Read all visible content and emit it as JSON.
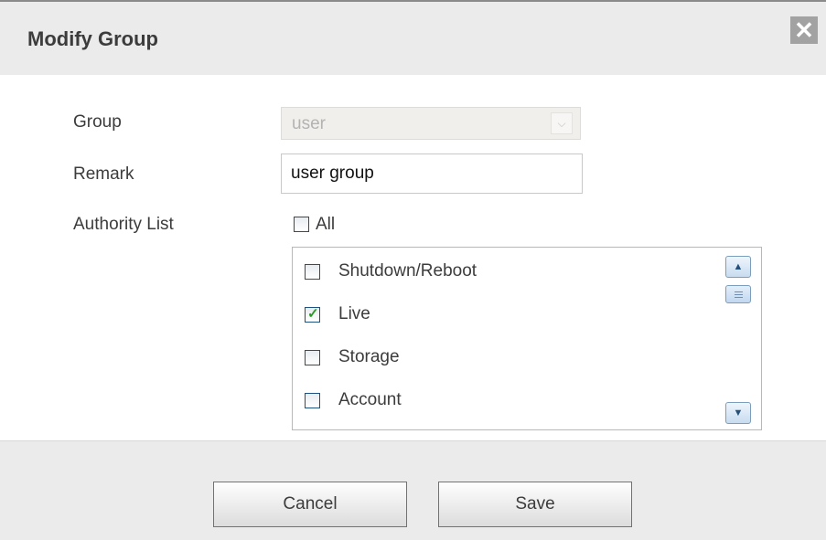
{
  "dialog": {
    "title": "Modify Group",
    "close_symbol": "✕"
  },
  "form": {
    "group_label": "Group",
    "group_value": "user",
    "remark_label": "Remark",
    "remark_value": "user group",
    "authority_label": "Authority List",
    "all_label": "All",
    "all_checked": false
  },
  "authority_items": [
    {
      "label": "Shutdown/Reboot",
      "checked": false
    },
    {
      "label": "Live",
      "checked": true
    },
    {
      "label": "Storage",
      "checked": false
    },
    {
      "label": "Account",
      "checked": false
    }
  ],
  "icons": {
    "close": "close-icon",
    "dropdown": "chevron-down-icon",
    "scroll_up": "chevron-up-icon",
    "scroll_down": "chevron-down-icon",
    "check": "checkmark-icon"
  },
  "buttons": {
    "cancel": "Cancel",
    "save": "Save"
  }
}
